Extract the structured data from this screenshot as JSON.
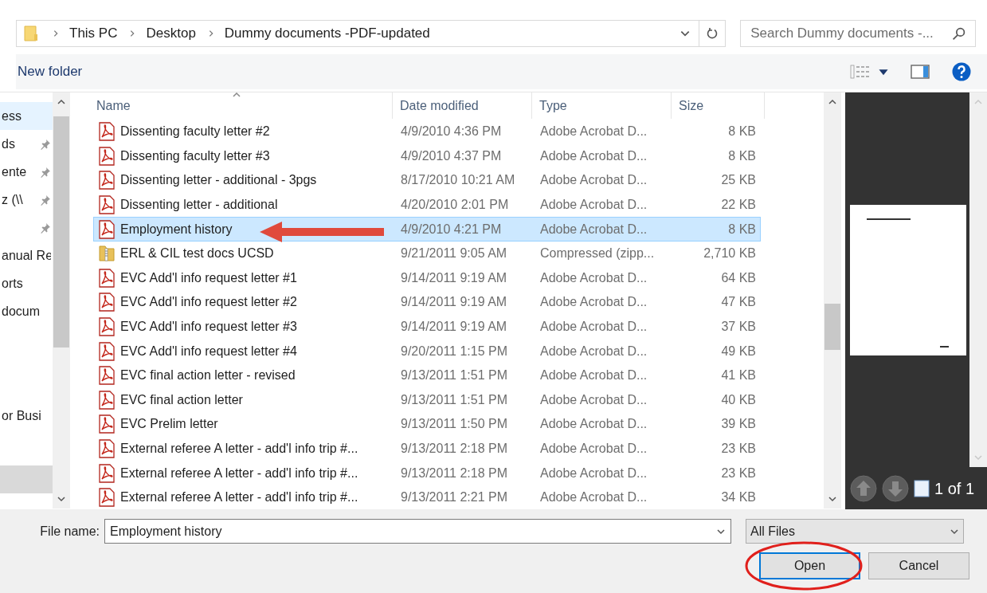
{
  "breadcrumb": [
    "This PC",
    "Desktop",
    "Dummy documents -PDF-updated"
  ],
  "search": {
    "placeholder": "Search Dummy documents -..."
  },
  "toolbar": {
    "new_folder": "New folder"
  },
  "sidebar": {
    "groups": [
      [
        {
          "kind": "item",
          "label": "ess",
          "pinned": false,
          "selected": true,
          "hovered": false
        },
        {
          "kind": "item",
          "label": "ds",
          "pinned": true,
          "selected": false,
          "hovered": false
        },
        {
          "kind": "item",
          "label": "ente",
          "pinned": true,
          "selected": false,
          "hovered": false
        },
        {
          "kind": "item",
          "label": "z (\\\\",
          "pinned": true,
          "selected": false,
          "hovered": false
        },
        {
          "kind": "item",
          "pinned": true,
          "selected": false,
          "hovered": false
        },
        {
          "kind": "item",
          "label": "anual Re",
          "pinned": false,
          "selected": false,
          "hovered": false
        },
        {
          "kind": "item",
          "label": "orts",
          "pinned": false,
          "selected": false,
          "hovered": false
        },
        {
          "kind": "item",
          "label": "docum",
          "pinned": false,
          "selected": false,
          "hovered": false
        }
      ],
      [
        {
          "kind": "item",
          "label": "or Busi",
          "pinned": false,
          "selected": false,
          "hovered": false
        }
      ],
      [
        {
          "kind": "item",
          "pinned": false,
          "selected": false,
          "hovered": true
        }
      ]
    ]
  },
  "columns": [
    "Name",
    "Date modified",
    "Type",
    "Size"
  ],
  "rows": [
    {
      "kind": "pdf",
      "name": "Dissenting faculty letter #2",
      "date": "4/9/2010 4:36 PM",
      "type": "Adobe Acrobat D...",
      "size": "8 KB",
      "selected": false
    },
    {
      "kind": "pdf",
      "name": "Dissenting faculty letter #3",
      "date": "4/9/2010 4:37 PM",
      "type": "Adobe Acrobat D...",
      "size": "8 KB",
      "selected": false
    },
    {
      "kind": "pdf",
      "name": "Dissenting letter - additional - 3pgs",
      "date": "8/17/2010 10:21 AM",
      "type": "Adobe Acrobat D...",
      "size": "25 KB",
      "selected": false
    },
    {
      "kind": "pdf",
      "name": "Dissenting letter - additional",
      "date": "4/20/2010 2:01 PM",
      "type": "Adobe Acrobat D...",
      "size": "22 KB",
      "selected": false
    },
    {
      "kind": "pdf",
      "name": "Employment history",
      "date": "4/9/2010 4:21 PM",
      "type": "Adobe Acrobat D...",
      "size": "8 KB",
      "selected": true
    },
    {
      "kind": "zip",
      "name": "ERL & CIL test docs UCSD",
      "date": "9/21/2011 9:05 AM",
      "type": "Compressed (zipp...",
      "size": "2,710 KB",
      "selected": false
    },
    {
      "kind": "pdf",
      "name": "EVC Add'l info request letter #1",
      "date": "9/14/2011 9:19 AM",
      "type": "Adobe Acrobat D...",
      "size": "64 KB",
      "selected": false
    },
    {
      "kind": "pdf",
      "name": "EVC Add'l info request letter #2",
      "date": "9/14/2011 9:19 AM",
      "type": "Adobe Acrobat D...",
      "size": "47 KB",
      "selected": false
    },
    {
      "kind": "pdf",
      "name": "EVC Add'l info request letter #3",
      "date": "9/14/2011 9:19 AM",
      "type": "Adobe Acrobat D...",
      "size": "37 KB",
      "selected": false
    },
    {
      "kind": "pdf",
      "name": "EVC Add'l info request letter #4",
      "date": "9/20/2011 1:15 PM",
      "type": "Adobe Acrobat D...",
      "size": "49 KB",
      "selected": false
    },
    {
      "kind": "pdf",
      "name": "EVC final action letter - revised",
      "date": "9/13/2011 1:51 PM",
      "type": "Adobe Acrobat D...",
      "size": "41 KB",
      "selected": false
    },
    {
      "kind": "pdf",
      "name": "EVC final action letter",
      "date": "9/13/2011 1:51 PM",
      "type": "Adobe Acrobat D...",
      "size": "40 KB",
      "selected": false
    },
    {
      "kind": "pdf",
      "name": "EVC Prelim letter",
      "date": "9/13/2011 1:50 PM",
      "type": "Adobe Acrobat D...",
      "size": "39 KB",
      "selected": false
    },
    {
      "kind": "pdf",
      "name": "External referee A letter - add'l info trip #...",
      "date": "9/13/2011 2:18 PM",
      "type": "Adobe Acrobat D...",
      "size": "23 KB",
      "selected": false
    },
    {
      "kind": "pdf",
      "name": "External referee A letter - add'l info trip #...",
      "date": "9/13/2011 2:18 PM",
      "type": "Adobe Acrobat D...",
      "size": "23 KB",
      "selected": false
    },
    {
      "kind": "pdf",
      "name": "External referee A letter - add'l info trip #...",
      "date": "9/13/2011 2:21 PM",
      "type": "Adobe Acrobat D...",
      "size": "34 KB",
      "selected": false
    }
  ],
  "preview": {
    "page_indicator": "1 of 1"
  },
  "file_name": {
    "label": "File name:",
    "value": "Employment history"
  },
  "file_type": "All Files",
  "buttons": [
    {
      "label": "Open",
      "default": true
    },
    {
      "label": "Cancel",
      "default": false
    }
  ]
}
